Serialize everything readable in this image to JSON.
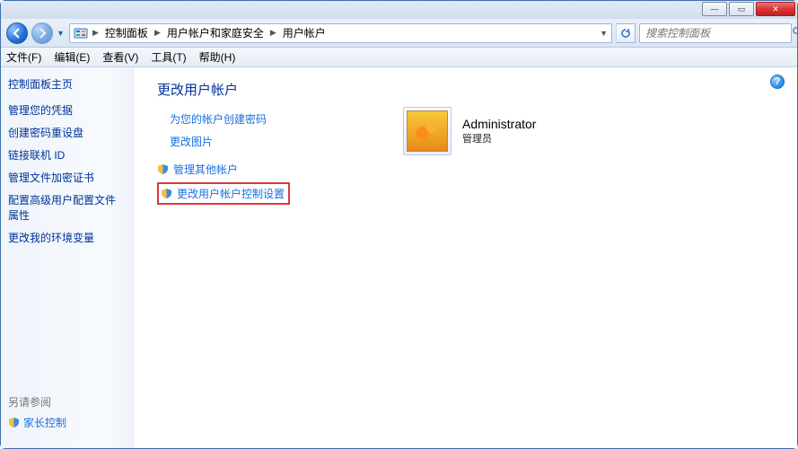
{
  "titlebar": {
    "minimize_glyph": "—",
    "maximize_glyph": "▭",
    "close_glyph": "✕"
  },
  "addrbar": {
    "breadcrumb": [
      "控制面板",
      "用户帐户和家庭安全",
      "用户帐户"
    ],
    "search_placeholder": "搜索控制面板"
  },
  "menubar": [
    "文件(F)",
    "编辑(E)",
    "查看(V)",
    "工具(T)",
    "帮助(H)"
  ],
  "sidebar": {
    "heading": "控制面板主页",
    "links": [
      "管理您的凭据",
      "创建密码重设盘",
      "链接联机 ID",
      "管理文件加密证书",
      "配置高级用户配置文件属性",
      "更改我的环境变量"
    ],
    "see_also": "另请参阅",
    "parental": "家长控制"
  },
  "content": {
    "title": "更改用户帐户",
    "task_links": [
      "为您的帐户创建密码",
      "更改图片"
    ],
    "shield_link1": "管理其他帐户",
    "shield_link2": "更改用户帐户控制设置",
    "account": {
      "name": "Administrator",
      "role": "管理员"
    }
  }
}
